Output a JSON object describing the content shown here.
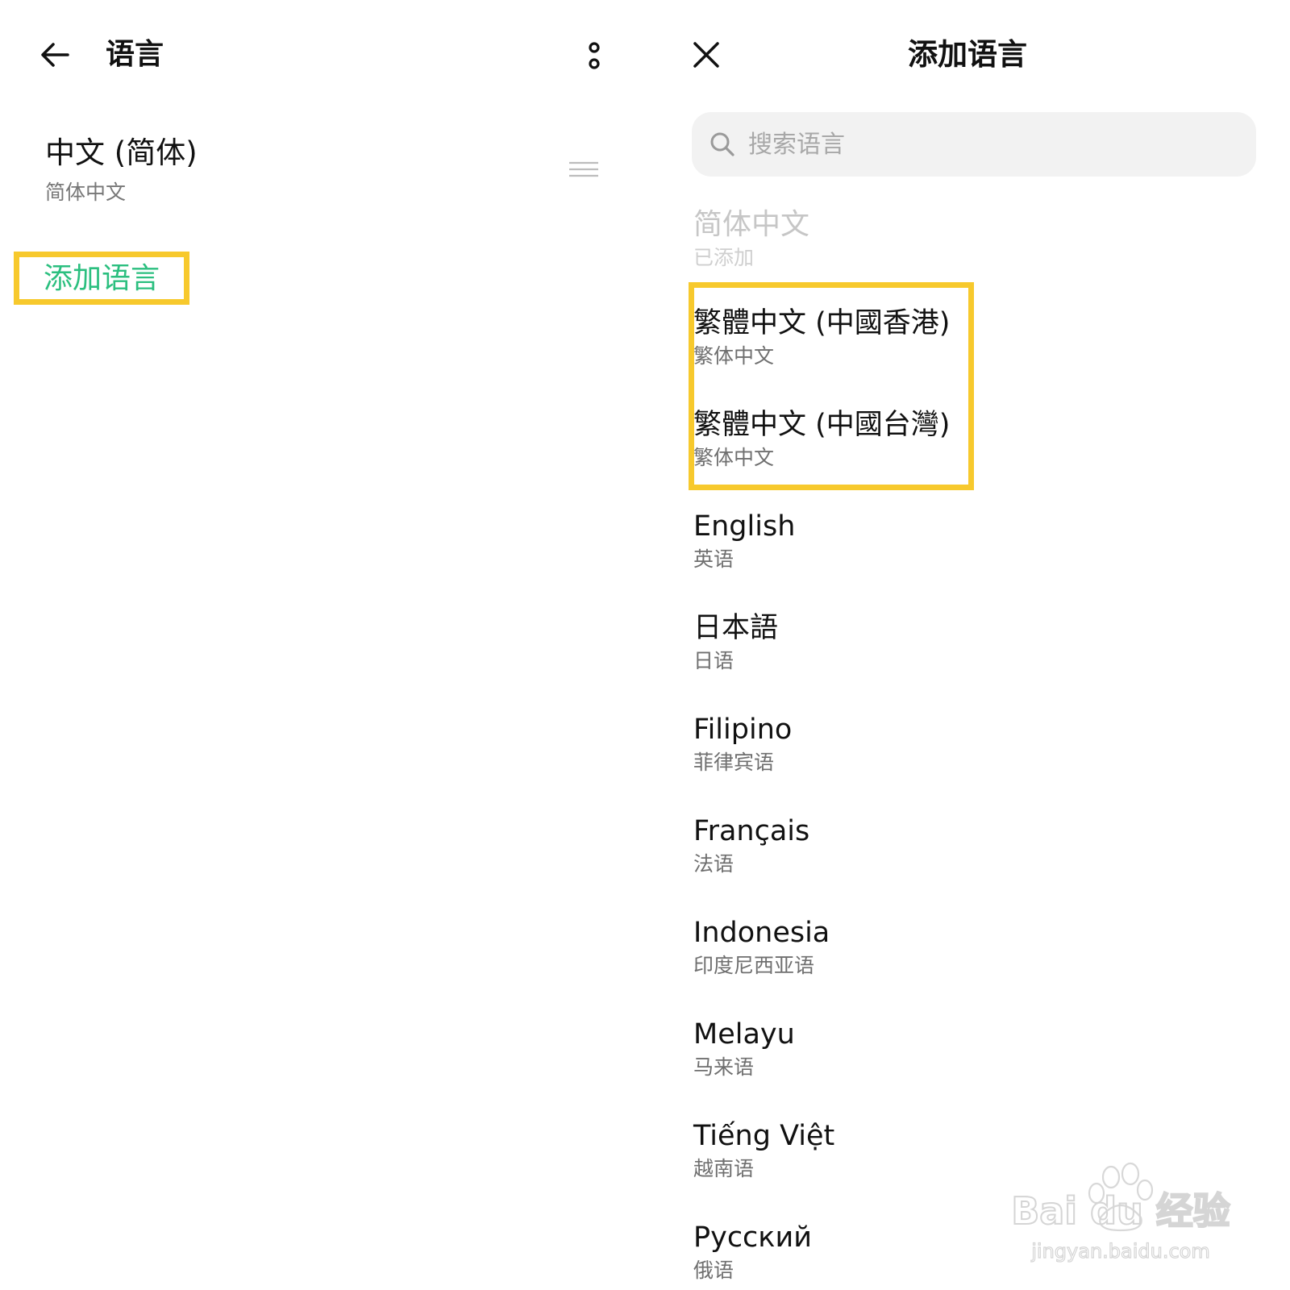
{
  "language_screen": {
    "title": "语言",
    "languages": [
      {
        "name": "中文 (简体)",
        "subtitle": "简体中文"
      }
    ],
    "add_language_label": "添加语言",
    "icons": {
      "back": "back-arrow-icon",
      "more": "more-vertical-icon",
      "drag": "drag-handle-icon"
    }
  },
  "add_language_screen": {
    "title": "添加语言",
    "search": {
      "placeholder": "搜索语言",
      "value": ""
    },
    "added": {
      "name": "简体中文",
      "status": "已添加"
    },
    "languages": [
      {
        "name": "繁體中文 (中國香港)",
        "subtitle": "繁体中文"
      },
      {
        "name": "繁體中文 (中國台灣)",
        "subtitle": "繁体中文"
      },
      {
        "name": "English",
        "subtitle": "英语"
      },
      {
        "name": "日本語",
        "subtitle": "日语"
      },
      {
        "name": "Filipino",
        "subtitle": "菲律宾语"
      },
      {
        "name": "Français",
        "subtitle": "法语"
      },
      {
        "name": "Indonesia",
        "subtitle": "印度尼西亚语"
      },
      {
        "name": "Melayu",
        "subtitle": "马来语"
      },
      {
        "name": "Tiếng Việt",
        "subtitle": "越南语"
      },
      {
        "name": "Русский",
        "subtitle": "俄语"
      }
    ],
    "icons": {
      "close": "close-icon",
      "search": "search-icon"
    }
  },
  "watermark": {
    "brand": "Bai du 经验",
    "url": "jingyan.baidu.com"
  },
  "colors": {
    "accent_green": "#2bbf7f",
    "highlight_yellow": "#f7c92d",
    "search_bg": "#f2f2f2"
  }
}
